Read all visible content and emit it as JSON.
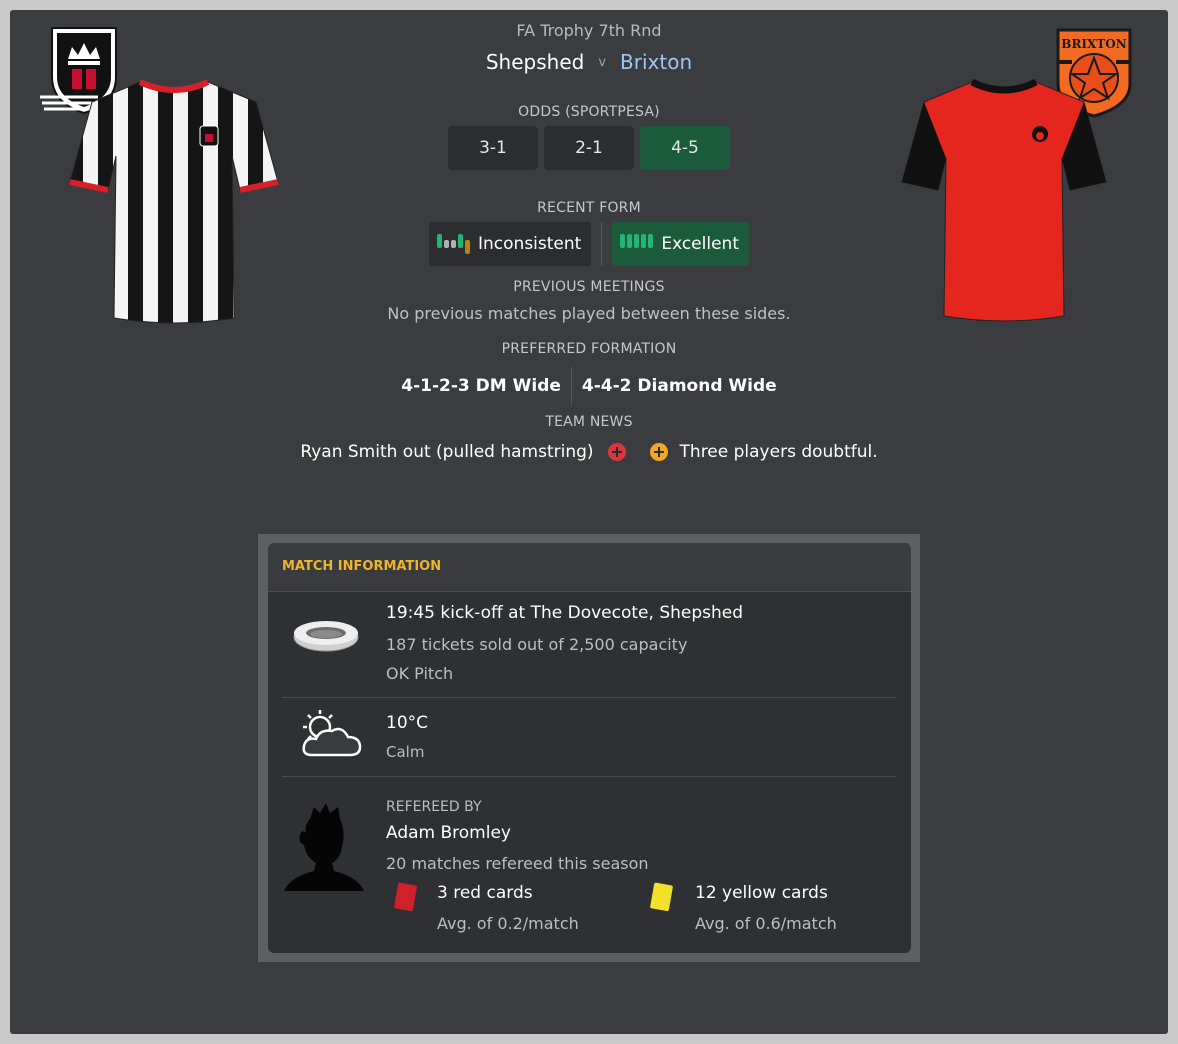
{
  "header": {
    "competition": "FA Trophy 7th Rnd",
    "home_team": "Shepshed",
    "vs": "v",
    "away_team": "Brixton"
  },
  "odds": {
    "title": "ODDS (SPORTPESA)",
    "values": [
      "3-1",
      "2-1",
      "4-5"
    ],
    "selected_index": 2
  },
  "recent_form": {
    "title": "RECENT FORM",
    "home": {
      "label": "Inconsistent",
      "bars": [
        "win",
        "draw",
        "draw",
        "win",
        "loss"
      ]
    },
    "away": {
      "label": "Excellent",
      "bars": [
        "win",
        "win",
        "win",
        "win",
        "win"
      ]
    }
  },
  "previous_meetings": {
    "title": "PREVIOUS MEETINGS",
    "text": "No previous matches played between these sides."
  },
  "formation": {
    "title": "PREFERRED FORMATION",
    "home": "4-1-2-3 DM Wide",
    "away": "4-4-2 Diamond Wide"
  },
  "team_news": {
    "title": "TEAM NEWS",
    "home": "Ryan Smith out (pulled hamstring)",
    "away": "Three players doubtful."
  },
  "match_info": {
    "title": "MATCH INFORMATION",
    "venue": {
      "kickoff": "19:45 kick-off at The Dovecote, Shepshed",
      "tickets": "187 tickets sold out of 2,500 capacity",
      "pitch": "OK Pitch"
    },
    "weather": {
      "temperature": "10°C",
      "wind": "Calm"
    },
    "referee": {
      "title": "REFEREED BY",
      "name": "Adam Bromley",
      "matches": "20 matches refereed this season",
      "red_cards": "3 red cards",
      "red_avg": "Avg. of 0.2/match",
      "yellow_cards": "12 yellow cards",
      "yellow_avg": "Avg. of 0.6/match"
    }
  },
  "colors": {
    "panel": "#3b3c40",
    "accent_selected": "#1c5a3c",
    "away_link": "#9ec6f0",
    "section_header": "#f0b429",
    "form_win": "#22b573",
    "form_draw": "#b3b3b3",
    "form_loss": "#b8860b",
    "home_news_icon": "#d9363e",
    "away_news_icon": "#f5a623",
    "red_card": "#d0202a",
    "yellow_card": "#f2e02a"
  },
  "icons": {
    "home_badge": "shield-crown-badge",
    "away_badge": "brixton-star-badge",
    "home_kit": "black-white-stripes-shirt",
    "away_kit": "red-black-shirt",
    "stadium": "stadium-icon",
    "weather": "partly-cloudy-icon",
    "referee": "person-silhouette-icon",
    "injury": "plus-circle-icon"
  }
}
